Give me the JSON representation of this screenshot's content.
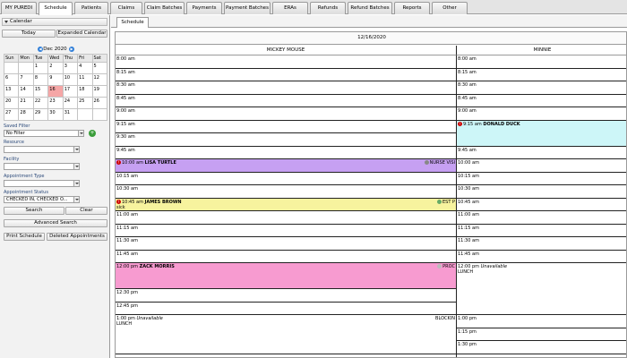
{
  "top_tabs": [
    {
      "label": "MY PUREDI",
      "w": 40
    },
    {
      "label": "Schedule",
      "w": 38,
      "active": true
    },
    {
      "label": "Patients",
      "w": 38
    },
    {
      "label": "Claims",
      "w": 36
    },
    {
      "label": "Claim Batches",
      "w": 45
    },
    {
      "label": "Payments",
      "w": 40
    },
    {
      "label": "Payment Batches",
      "w": 52
    },
    {
      "label": "ERAs",
      "w": 40
    },
    {
      "label": "Refunds",
      "w": 40
    },
    {
      "label": "Refund Batches",
      "w": 50
    },
    {
      "label": "Reports",
      "w": 40
    },
    {
      "label": "Other",
      "w": 40
    }
  ],
  "left": {
    "calendar_label": "Calendar",
    "today_label": "Today",
    "expanded_label": "Expanded Calendar",
    "month_label": "Dec 2020",
    "day_headers": [
      "Sun",
      "Mon",
      "Tue",
      "Wed",
      "Thu",
      "Fri",
      "Sat"
    ],
    "weeks": [
      [
        "",
        "",
        "1",
        "2",
        "3",
        "4",
        "5"
      ],
      [
        "6",
        "7",
        "8",
        "9",
        "10",
        "11",
        "12"
      ],
      [
        "13",
        "14",
        "15",
        "16",
        "17",
        "18",
        "19"
      ],
      [
        "20",
        "21",
        "22",
        "23",
        "24",
        "25",
        "26"
      ],
      [
        "27",
        "28",
        "29",
        "30",
        "31",
        "",
        ""
      ]
    ],
    "selected_day": "16",
    "saved_filter_label": "Saved Filter",
    "saved_filter_value": "No Filter",
    "resource_label": "Resource",
    "resource_value": "",
    "facility_label": "Facility",
    "facility_value": "",
    "appt_type_label": "Appointment Type",
    "appt_type_value": "",
    "appt_status_label": "Appointment Status",
    "appt_status_value": "CHECKED IN, CHECKED O...",
    "search_label": "Search",
    "clear_label": "Clear",
    "advanced_label": "Advanced Search",
    "print_label": "Print Schedule",
    "deleted_label": "Deleted Appointments"
  },
  "schedule": {
    "subtab_label": "Schedule",
    "date": "12/16/2020",
    "providers": [
      "MICKEY MOUSE",
      "MINNIE"
    ],
    "mickey": [
      {
        "time": "8:00 am",
        "slots": 1
      },
      {
        "time": "8:15 am",
        "slots": 1
      },
      {
        "time": "8:30 am",
        "slots": 1
      },
      {
        "time": "8:45 am",
        "slots": 1
      },
      {
        "time": "9:00 am",
        "slots": 1
      },
      {
        "time": "9:15 am",
        "slots": 1
      },
      {
        "time": "9:30 am",
        "slots": 1
      },
      {
        "time": "9:45 am",
        "slots": 1
      },
      {
        "time": "10:00 am",
        "slots": 1,
        "name": "LISA TURTLE",
        "color": "#c6a0f2",
        "right": "NURSE VISI",
        "alert": true,
        "ricon": "#888"
      },
      {
        "time": "10:15 am",
        "slots": 1
      },
      {
        "time": "10:30 am",
        "slots": 1
      },
      {
        "time": "10:45 am",
        "slots": 1,
        "name": "JAMES BROWN",
        "sub": "sick",
        "color": "#f7f39e",
        "right": "EST P",
        "alert": true,
        "ricon": "#66aa66"
      },
      {
        "time": "11:00 am",
        "slots": 1
      },
      {
        "time": "11:15 am",
        "slots": 1
      },
      {
        "time": "11:30 am",
        "slots": 1
      },
      {
        "time": "11:45 am",
        "slots": 1
      },
      {
        "time": "12:00 pm",
        "slots": 2,
        "name": "ZACK MORRIS",
        "color": "#f79bd0",
        "right": "PROC",
        "ricon": "#bbbbbb"
      },
      {
        "time": "12:30 pm",
        "slots": 1
      },
      {
        "time": "12:45 pm",
        "slots": 1
      },
      {
        "time": "1:00 pm",
        "slots": 3,
        "italic": "Unavailable",
        "sub": "LUNCH",
        "right": "BLOCKIN"
      }
    ],
    "minnie": [
      {
        "time": "8:00 am",
        "slots": 1
      },
      {
        "time": "8:15 am",
        "slots": 1
      },
      {
        "time": "8:30 am",
        "slots": 1
      },
      {
        "time": "8:45 am",
        "slots": 1
      },
      {
        "time": "9:00 am",
        "slots": 1
      },
      {
        "time": "9:15 am",
        "slots": 2,
        "name": "DONALD DUCK",
        "color": "#cdf6f8",
        "alert": true
      },
      {
        "time": "9:45 am",
        "slots": 1
      },
      {
        "time": "10:00 am",
        "slots": 1
      },
      {
        "time": "10:15 am",
        "slots": 1
      },
      {
        "time": "10:30 am",
        "slots": 1
      },
      {
        "time": "10:45 am",
        "slots": 1
      },
      {
        "time": "11:00 am",
        "slots": 1
      },
      {
        "time": "11:15 am",
        "slots": 1
      },
      {
        "time": "11:30 am",
        "slots": 1
      },
      {
        "time": "11:45 am",
        "slots": 1
      },
      {
        "time": "12:00 pm",
        "slots": 4,
        "italic": "Unavailable",
        "sub": "LUNCH"
      },
      {
        "time": "1:00 pm",
        "slots": 1
      },
      {
        "time": "1:15 pm",
        "slots": 1
      },
      {
        "time": "1:30 pm",
        "slots": 1
      }
    ]
  }
}
